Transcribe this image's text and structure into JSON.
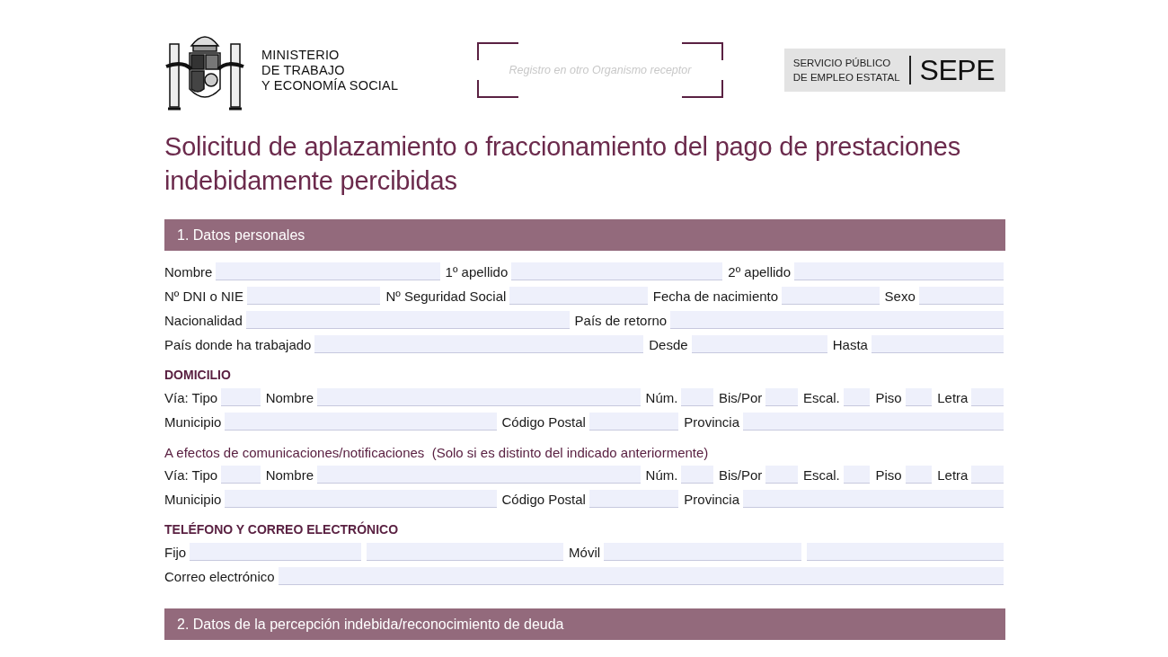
{
  "header": {
    "ministry": [
      "MINISTERIO",
      "DE TRABAJO",
      "Y ECONOMÍA SOCIAL"
    ],
    "registry": {
      "placeholder": "Registro en otro Organismo receptor"
    },
    "agency": {
      "lines": [
        "SERVICIO PÚBLICO",
        "DE EMPLEO ESTATAL"
      ],
      "brand": "SEPE"
    }
  },
  "title": "Solicitud de aplazamiento o fraccionamiento del pago de prestaciones indebidamente percibidas",
  "sections": [
    {
      "heading": "1. Datos personales",
      "blocks": [
        {
          "kind": "rows",
          "rows": [
            [
              {
                "kind": "label",
                "text": "Nombre"
              },
              {
                "kind": "field"
              },
              {
                "kind": "label",
                "text": "1º apellido"
              },
              {
                "kind": "field"
              },
              {
                "kind": "label",
                "text": "2º apellido"
              },
              {
                "kind": "field"
              }
            ],
            [
              {
                "kind": "label",
                "text": "Nº DNI o NIE"
              },
              {
                "kind": "field"
              },
              {
                "kind": "label",
                "text": "Nº Seguridad Social"
              },
              {
                "kind": "field"
              },
              {
                "kind": "label",
                "text": "Fecha de nacimiento"
              },
              {
                "kind": "field"
              },
              {
                "kind": "label",
                "text": "Sexo"
              },
              {
                "kind": "field"
              }
            ],
            [
              {
                "kind": "label",
                "text": "Nacionalidad"
              },
              {
                "kind": "field"
              },
              {
                "kind": "label",
                "text": "País de retorno"
              },
              {
                "kind": "field"
              }
            ],
            [
              {
                "kind": "label",
                "text": "País donde ha trabajado"
              },
              {
                "kind": "field"
              },
              {
                "kind": "label",
                "text": "Desde"
              },
              {
                "kind": "field"
              },
              {
                "kind": "label",
                "text": "Hasta"
              },
              {
                "kind": "field"
              }
            ]
          ]
        },
        {
          "kind": "subheading",
          "text": "DOMICILIO"
        },
        {
          "kind": "rows",
          "rows": [
            [
              {
                "kind": "label",
                "text": "Vía: Tipo"
              },
              {
                "kind": "field"
              },
              {
                "kind": "label",
                "text": "Nombre"
              },
              {
                "kind": "field"
              },
              {
                "kind": "label",
                "text": "Núm."
              },
              {
                "kind": "field"
              },
              {
                "kind": "label",
                "text": "Bis/Por"
              },
              {
                "kind": "field"
              },
              {
                "kind": "label",
                "text": "Escal."
              },
              {
                "kind": "field"
              },
              {
                "kind": "label",
                "text": "Piso"
              },
              {
                "kind": "field"
              },
              {
                "kind": "label",
                "text": "Letra"
              },
              {
                "kind": "field"
              }
            ],
            [
              {
                "kind": "label",
                "text": "Municipio"
              },
              {
                "kind": "field"
              },
              {
                "kind": "label",
                "text": "Código Postal"
              },
              {
                "kind": "field"
              },
              {
                "kind": "label",
                "text": "Provincia"
              },
              {
                "kind": "field"
              }
            ]
          ]
        },
        {
          "kind": "note",
          "text": "A efectos de comunicaciones/notificaciones  (Solo si es distinto del indicado anteriormente)"
        },
        {
          "kind": "rows",
          "rows": [
            [
              {
                "kind": "label",
                "text": "Vía: Tipo"
              },
              {
                "kind": "field"
              },
              {
                "kind": "label",
                "text": "Nombre"
              },
              {
                "kind": "field"
              },
              {
                "kind": "label",
                "text": "Núm."
              },
              {
                "kind": "field"
              },
              {
                "kind": "label",
                "text": "Bis/Por"
              },
              {
                "kind": "field"
              },
              {
                "kind": "label",
                "text": "Escal."
              },
              {
                "kind": "field"
              },
              {
                "kind": "label",
                "text": "Piso"
              },
              {
                "kind": "field"
              },
              {
                "kind": "label",
                "text": "Letra"
              },
              {
                "kind": "field"
              }
            ],
            [
              {
                "kind": "label",
                "text": "Municipio"
              },
              {
                "kind": "field"
              },
              {
                "kind": "label",
                "text": "Código Postal"
              },
              {
                "kind": "field"
              },
              {
                "kind": "label",
                "text": "Provincia"
              },
              {
                "kind": "field"
              }
            ]
          ]
        },
        {
          "kind": "subheading",
          "text": "TELÉFONO Y CORREO ELECTRÓNICO"
        },
        {
          "kind": "rows",
          "rows": [
            [
              {
                "kind": "label",
                "text": "Fijo"
              },
              {
                "kind": "field"
              },
              {
                "kind": "field"
              },
              {
                "kind": "label",
                "text": "Móvil"
              },
              {
                "kind": "field"
              },
              {
                "kind": "field"
              }
            ],
            [
              {
                "kind": "label",
                "text": "Correo electrónico"
              },
              {
                "kind": "field"
              }
            ]
          ]
        }
      ]
    },
    {
      "heading": "2. Datos de la percepción indebida/reconocimiento de deuda"
    }
  ]
}
